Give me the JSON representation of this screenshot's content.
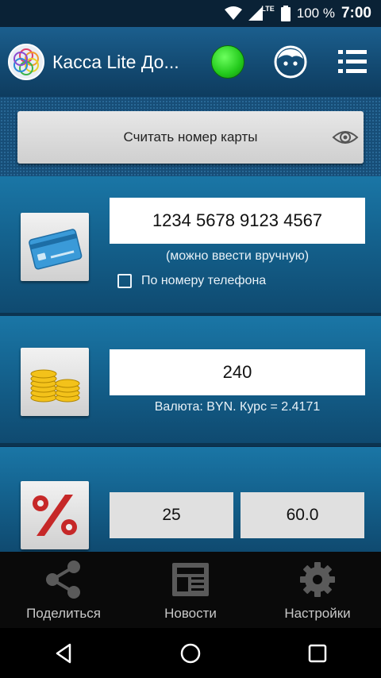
{
  "status_bar": {
    "network": "LTE",
    "battery": "100 %",
    "time": "7:00"
  },
  "app_bar": {
    "title": "Касса Lite До...",
    "status_color": "#22c91b"
  },
  "read_card": {
    "label": "Считать номер карты"
  },
  "card": {
    "number": "1234 5678 9123 4567",
    "hint": "(можно ввести вручную)",
    "phone_checkbox_label": "По номеру телефона",
    "phone_checkbox_checked": false
  },
  "amount": {
    "value": "240",
    "currency_info": "Валюта: BYN. Курс = 2.4171"
  },
  "discount": {
    "percent": "25",
    "value": "60.0"
  },
  "bottom_nav": {
    "share": "Поделиться",
    "news": "Новости",
    "settings": "Настройки"
  },
  "colors": {
    "accent": "#14628e",
    "appbar": "#134a72"
  }
}
